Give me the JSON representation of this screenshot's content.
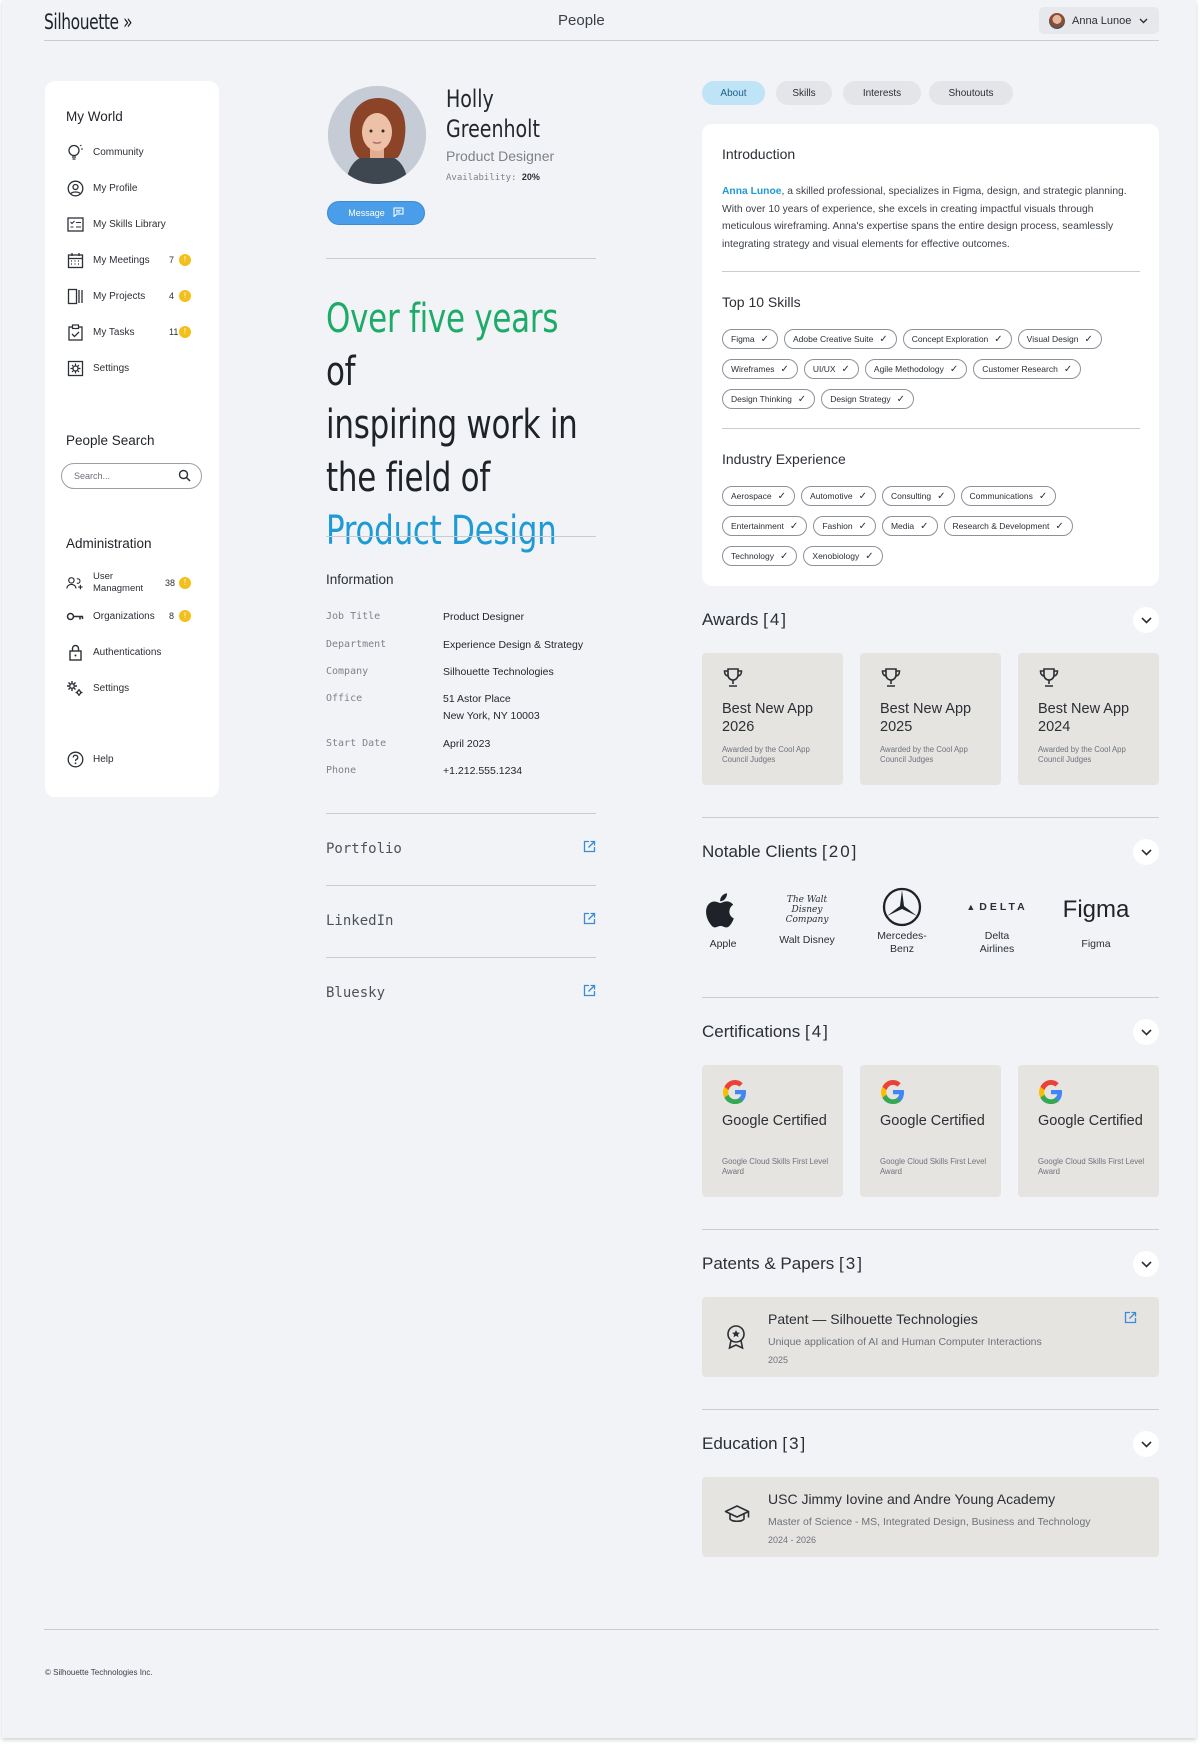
{
  "header": {
    "brand": "Silhouette »",
    "title": "People",
    "user_name": "Anna Lunoe"
  },
  "sidebar": {
    "my_world_title": "My World",
    "my_world_items": [
      {
        "label": "Community",
        "icon": "lightbulb-icon"
      },
      {
        "label": "My Profile",
        "icon": "user-circle-icon"
      },
      {
        "label": "My Skills Library",
        "icon": "checklist-icon"
      },
      {
        "label": "My Meetings",
        "icon": "calendar-icon",
        "count": "7"
      },
      {
        "label": "My Projects",
        "icon": "columns-icon",
        "count": "4"
      },
      {
        "label": "My Tasks",
        "icon": "clipboard-icon",
        "count": "11"
      },
      {
        "label": "Settings",
        "icon": "settings-icon"
      }
    ],
    "people_search_title": "People Search",
    "search_placeholder": "Search...",
    "admin_title": "Administration",
    "admin_items": [
      {
        "label": "User\nManagment",
        "icon": "users-icon",
        "count": "38"
      },
      {
        "label": "Organizations",
        "icon": "key-icon",
        "count": "8"
      },
      {
        "label": "Authentications",
        "icon": "lock-icon"
      },
      {
        "label": "Settings",
        "icon": "gears-icon"
      }
    ],
    "help_label": "Help"
  },
  "profile": {
    "first_name": "Holly",
    "last_name": "Greenholt",
    "role": "Product Designer",
    "availability_label": "Availability:",
    "availability_value": "20%",
    "message_label": "Message",
    "headline_1": "Over five years",
    "headline_2": " of",
    "headline_3": "inspiring work in",
    "headline_4": "the field of",
    "headline_5": "Product Design",
    "information_title": "Information",
    "info": [
      {
        "key": "Job Title",
        "value": "Product Designer"
      },
      {
        "key": "Department",
        "value": "Experience Design & Strategy"
      },
      {
        "key": "Company",
        "value": "Silhouette Technologies"
      },
      {
        "key": "Office",
        "value": "51 Astor Place\nNew York, NY  10003"
      },
      {
        "key": "Start Date",
        "value": "April 2023"
      },
      {
        "key": "Phone",
        "value": "+1.212.555.1234"
      }
    ],
    "links": [
      "Portfolio",
      "LinkedIn",
      "Bluesky"
    ]
  },
  "tabs": [
    "About",
    "Skills",
    "Interests",
    "Shoutouts"
  ],
  "about": {
    "intro_title": "Introduction",
    "intro_name": "Anna Lunoe",
    "intro_text": ", a skilled professional, specializes in Figma, design, and strategic planning. With over 10 years of experience, she excels in creating impactful visuals through meticulous wireframing. Anna's expertise spans the entire design process, seamlessly integrating strategy and visual elements for effective outcomes.",
    "skills_title": "Top 10 Skills",
    "skills": [
      "Figma",
      "Adobe Creative Suite",
      "Concept Exploration",
      "Visual Design",
      "Wireframes",
      "UI/UX",
      "Agile Methodology",
      "Customer Research",
      "Design Thinking",
      "Design Strategy"
    ],
    "industry_title": "Industry Experience",
    "industries": [
      "Aerospace",
      "Automotive",
      "Consulting",
      "Communications",
      "Entertainment",
      "Fashion",
      "Media",
      "Research & Development",
      "Technology",
      "Xenobiology"
    ]
  },
  "awards": {
    "title": "Awards",
    "count": "[4]",
    "items": [
      {
        "title": "Best New App 2026",
        "sub": "Awarded by the Cool App Council Judges"
      },
      {
        "title": "Best New App 2025",
        "sub": "Awarded by the Cool App Council Judges"
      },
      {
        "title": "Best New App 2024",
        "sub": "Awarded by the Cool App Council Judges"
      }
    ]
  },
  "clients": {
    "title": "Notable Clients",
    "count": "[20]",
    "disney_logo_text": "The Walt Disney Company",
    "delta_logo_text": "DELTA",
    "figma_logo_text": "Figma",
    "items": [
      {
        "name": "Apple",
        "icon": "apple-logo"
      },
      {
        "name": "Walt Disney",
        "icon": "disney-logo"
      },
      {
        "name": "Mercedes-\nBenz",
        "icon": "mercedes-logo"
      },
      {
        "name": "Delta\nAirlines",
        "icon": "delta-logo"
      },
      {
        "name": "Figma",
        "icon": "figma-logo"
      }
    ]
  },
  "certifications": {
    "title": "Certifications",
    "count": "[4]",
    "items": [
      {
        "title": "Google Certified",
        "sub": "Google Cloud Skills First Level Award"
      },
      {
        "title": "Google Certified",
        "sub": "Google Cloud Skills First Level Award"
      },
      {
        "title": "Google Certified",
        "sub": "Google Cloud Skills First Level Award"
      }
    ]
  },
  "patents": {
    "title": "Patents & Papers",
    "count": "[3]",
    "item_title": "Patent — Silhouette Technologies",
    "item_sub": "Unique application of AI and Human Computer Interactions",
    "item_year": "2025"
  },
  "education": {
    "title": "Education",
    "count": "[3]",
    "item_title": "USC Jimmy Iovine and Andre Young Academy",
    "item_sub": "Master of Science - MS, Integrated Design, Business and Technology",
    "item_year": "2024 - 2026"
  },
  "footer": "© Silhouette Technologies Inc.",
  "colors": {
    "accent_blue": "#1e9ad6",
    "accent_green": "#1dab6a",
    "badge_yellow": "#f3c01b",
    "button_blue": "#4a9de8"
  }
}
